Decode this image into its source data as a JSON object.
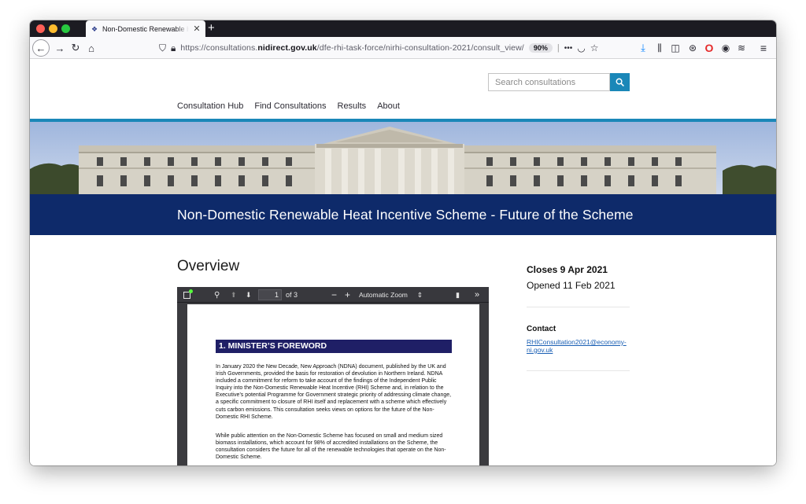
{
  "browser": {
    "tab_title": "Non-Domestic Renewable Heat Ince",
    "url_prefix": "https://consultations.",
    "url_domain": "nidirect.gov.uk",
    "url_path": "/dfe-rhi-task-force/nirhi-consultation-2021/consult_view/",
    "zoom": "90%",
    "more_label": "•••"
  },
  "site": {
    "search_placeholder": "Search consultations",
    "nav": [
      "Consultation Hub",
      "Find Consultations",
      "Results",
      "About"
    ],
    "page_title": "Non-Domestic Renewable Heat Incentive Scheme - Future of the Scheme",
    "overview_heading": "Overview",
    "closes": "Closes 9 Apr 2021",
    "opened": "Opened 11 Feb 2021",
    "contact_heading": "Contact",
    "contact_email": "RHIConsultation2021@economy-ni.gov.uk"
  },
  "pdf_viewer": {
    "page_number": "1",
    "page_count": "of 3",
    "zoom_option": "Automatic Zoom",
    "heading": "1.   MINISTER’S FOREWORD",
    "paragraph_1": "In January 2020 the New Decade, New Approach (NDNA) document, published by the UK and Irish Governments, provided the basis for restoration of devolution in Northern Ireland. NDNA included a commitment for reform to take account of the findings of the Independent Public Inquiry into the Non-Domestic Renewable Heat Incentive (RHI) Scheme and, in relation to the Executive’s potential Programme for Government strategic priority of addressing climate change, a specific commitment to closure of RHI itself and replacement with a scheme which effectively cuts carbon emissions. This consultation seeks views on options for the future of the Non-Domestic RHI Scheme.",
    "paragraph_2": "While public attention on the Non-Domestic Scheme has focused on small and medium sized biomass installations, which account for 98% of accredited installations on the Scheme, the consultation considers the future for all of the renewable technologies that operate on the Non-Domestic Scheme."
  },
  "colors": {
    "accent_blue": "#1a87b8",
    "title_band": "#0e2a6a",
    "pdf_heading": "#1f1f66",
    "link": "#1a5fb4"
  }
}
